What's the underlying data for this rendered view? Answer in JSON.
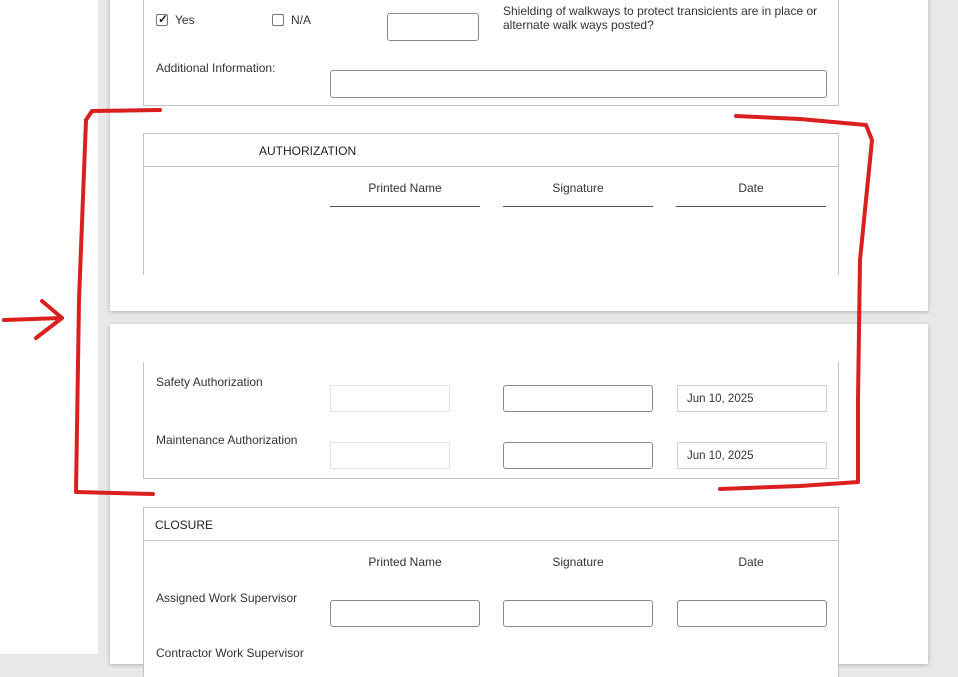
{
  "top_section": {
    "yes_label": "Yes",
    "yes_checked": true,
    "na_label": "N/A",
    "question": "Shielding of walkways to protect transicients are in place or alternate walk ways posted?",
    "additional_label": "Additional Information:"
  },
  "authorization": {
    "title": "AUTHORIZATION",
    "col_printed": "Printed Name",
    "col_signature": "Signature",
    "col_date": "Date",
    "rows": [
      {
        "label": "Safety Authorization",
        "date": "Jun 10, 2025"
      },
      {
        "label": "Maintenance Authorization",
        "date": "Jun 10, 2025"
      }
    ]
  },
  "closure": {
    "title": "CLOSURE",
    "col_printed": "Printed Name",
    "col_signature": "Signature",
    "col_date": "Date",
    "rows": [
      {
        "label": "Assigned Work Supervisor"
      },
      {
        "label": "Contractor Work Supervisor"
      }
    ]
  },
  "annotation_color": "#d9201f"
}
